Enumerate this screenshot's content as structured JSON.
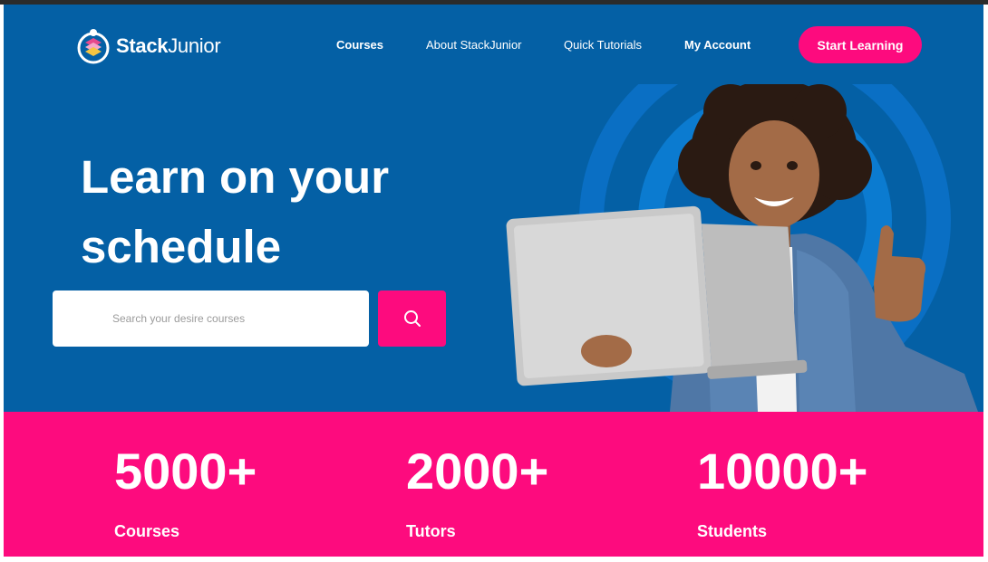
{
  "brand": {
    "name_bold": "Stack",
    "name_light": "Junior",
    "colors": {
      "primary_blue": "#0460a5",
      "accent_pink": "#fd0b7e"
    },
    "logo_icon": "stack-layers-icon"
  },
  "nav": {
    "items": [
      {
        "label": "Courses"
      },
      {
        "label": "About StackJunior"
      },
      {
        "label": "Quick Tutorials"
      },
      {
        "label": "My Account"
      }
    ],
    "cta_label": "Start Learning"
  },
  "hero": {
    "headline_line1": "Learn on your",
    "headline_line2": "schedule",
    "search": {
      "placeholder": "Search your desire courses",
      "value": "",
      "button_icon": "search-icon"
    },
    "illustration": "girl-with-laptop-thumbs-up"
  },
  "stats": [
    {
      "value": "5000+",
      "label": "Courses"
    },
    {
      "value": "2000+",
      "label": "Tutors"
    },
    {
      "value": "10000+",
      "label": "Students"
    }
  ]
}
